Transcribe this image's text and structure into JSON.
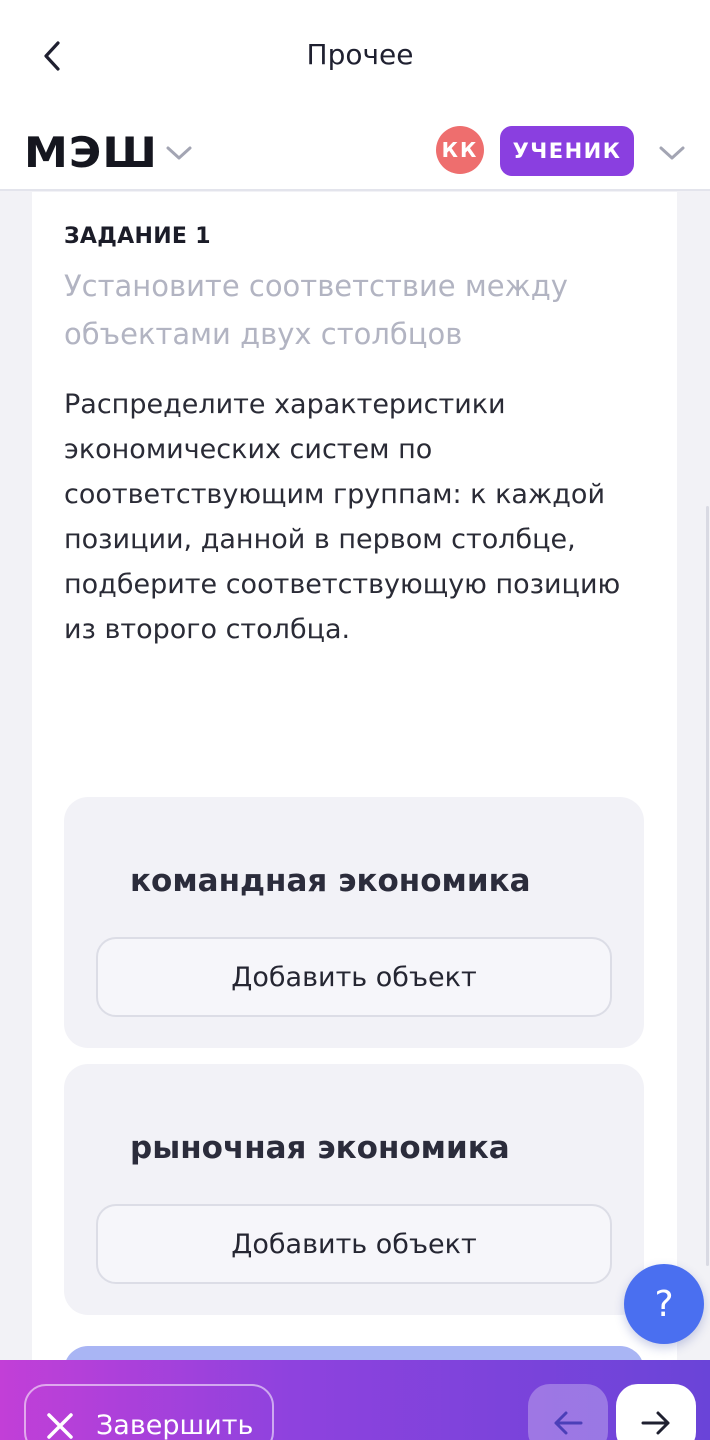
{
  "header": {
    "title": "Прочее"
  },
  "brand": {
    "logo_text": "МЭШ"
  },
  "user": {
    "initials": "КК",
    "role": "УЧЕНИК",
    "avatar_color": "#ee6e6e",
    "role_color": "#8a3fe0"
  },
  "task": {
    "label": "ЗАДАНИЕ 1",
    "type": "Установите соответствие между объектами двух столбцов",
    "text": "Распределите характеристики экономических систем по соответствующим группам: к каждой позиции, данной в первом столбце, подберите соответствующую позицию из второго столбца."
  },
  "groups": [
    {
      "title": "командная экономика",
      "add_label": "Добавить объект"
    },
    {
      "title": "рыночная экономика",
      "add_label": "Добавить объект"
    }
  ],
  "help": {
    "label": "?"
  },
  "footer": {
    "finish_label": "Завершить"
  }
}
